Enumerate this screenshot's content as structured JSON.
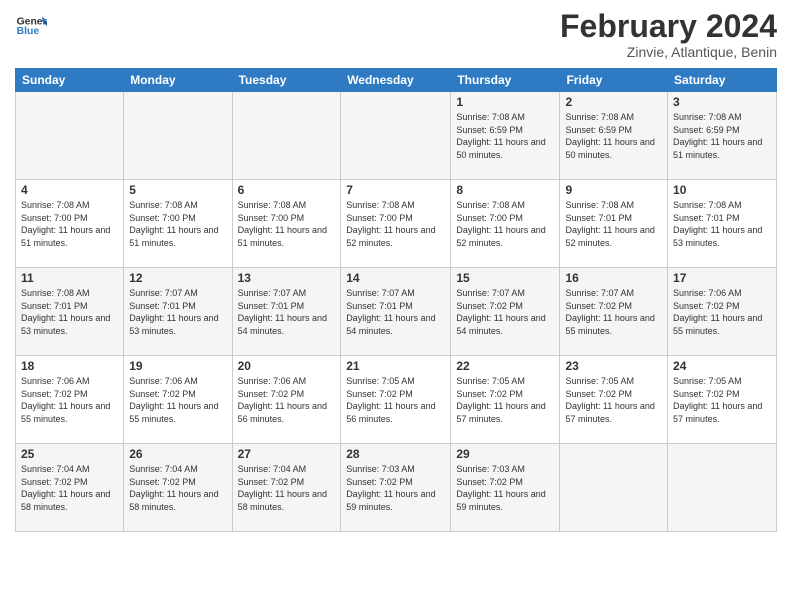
{
  "logo": {
    "text_general": "General",
    "text_blue": "Blue"
  },
  "header": {
    "month_year": "February 2024",
    "location": "Zinvie, Atlantique, Benin"
  },
  "weekdays": [
    "Sunday",
    "Monday",
    "Tuesday",
    "Wednesday",
    "Thursday",
    "Friday",
    "Saturday"
  ],
  "weeks": [
    [
      {
        "day": "",
        "sunrise": "",
        "sunset": "",
        "daylight": ""
      },
      {
        "day": "",
        "sunrise": "",
        "sunset": "",
        "daylight": ""
      },
      {
        "day": "",
        "sunrise": "",
        "sunset": "",
        "daylight": ""
      },
      {
        "day": "",
        "sunrise": "",
        "sunset": "",
        "daylight": ""
      },
      {
        "day": "1",
        "sunrise": "Sunrise: 7:08 AM",
        "sunset": "Sunset: 6:59 PM",
        "daylight": "Daylight: 11 hours and 50 minutes."
      },
      {
        "day": "2",
        "sunrise": "Sunrise: 7:08 AM",
        "sunset": "Sunset: 6:59 PM",
        "daylight": "Daylight: 11 hours and 50 minutes."
      },
      {
        "day": "3",
        "sunrise": "Sunrise: 7:08 AM",
        "sunset": "Sunset: 6:59 PM",
        "daylight": "Daylight: 11 hours and 51 minutes."
      }
    ],
    [
      {
        "day": "4",
        "sunrise": "Sunrise: 7:08 AM",
        "sunset": "Sunset: 7:00 PM",
        "daylight": "Daylight: 11 hours and 51 minutes."
      },
      {
        "day": "5",
        "sunrise": "Sunrise: 7:08 AM",
        "sunset": "Sunset: 7:00 PM",
        "daylight": "Daylight: 11 hours and 51 minutes."
      },
      {
        "day": "6",
        "sunrise": "Sunrise: 7:08 AM",
        "sunset": "Sunset: 7:00 PM",
        "daylight": "Daylight: 11 hours and 51 minutes."
      },
      {
        "day": "7",
        "sunrise": "Sunrise: 7:08 AM",
        "sunset": "Sunset: 7:00 PM",
        "daylight": "Daylight: 11 hours and 52 minutes."
      },
      {
        "day": "8",
        "sunrise": "Sunrise: 7:08 AM",
        "sunset": "Sunset: 7:00 PM",
        "daylight": "Daylight: 11 hours and 52 minutes."
      },
      {
        "day": "9",
        "sunrise": "Sunrise: 7:08 AM",
        "sunset": "Sunset: 7:01 PM",
        "daylight": "Daylight: 11 hours and 52 minutes."
      },
      {
        "day": "10",
        "sunrise": "Sunrise: 7:08 AM",
        "sunset": "Sunset: 7:01 PM",
        "daylight": "Daylight: 11 hours and 53 minutes."
      }
    ],
    [
      {
        "day": "11",
        "sunrise": "Sunrise: 7:08 AM",
        "sunset": "Sunset: 7:01 PM",
        "daylight": "Daylight: 11 hours and 53 minutes."
      },
      {
        "day": "12",
        "sunrise": "Sunrise: 7:07 AM",
        "sunset": "Sunset: 7:01 PM",
        "daylight": "Daylight: 11 hours and 53 minutes."
      },
      {
        "day": "13",
        "sunrise": "Sunrise: 7:07 AM",
        "sunset": "Sunset: 7:01 PM",
        "daylight": "Daylight: 11 hours and 54 minutes."
      },
      {
        "day": "14",
        "sunrise": "Sunrise: 7:07 AM",
        "sunset": "Sunset: 7:01 PM",
        "daylight": "Daylight: 11 hours and 54 minutes."
      },
      {
        "day": "15",
        "sunrise": "Sunrise: 7:07 AM",
        "sunset": "Sunset: 7:02 PM",
        "daylight": "Daylight: 11 hours and 54 minutes."
      },
      {
        "day": "16",
        "sunrise": "Sunrise: 7:07 AM",
        "sunset": "Sunset: 7:02 PM",
        "daylight": "Daylight: 11 hours and 55 minutes."
      },
      {
        "day": "17",
        "sunrise": "Sunrise: 7:06 AM",
        "sunset": "Sunset: 7:02 PM",
        "daylight": "Daylight: 11 hours and 55 minutes."
      }
    ],
    [
      {
        "day": "18",
        "sunrise": "Sunrise: 7:06 AM",
        "sunset": "Sunset: 7:02 PM",
        "daylight": "Daylight: 11 hours and 55 minutes."
      },
      {
        "day": "19",
        "sunrise": "Sunrise: 7:06 AM",
        "sunset": "Sunset: 7:02 PM",
        "daylight": "Daylight: 11 hours and 55 minutes."
      },
      {
        "day": "20",
        "sunrise": "Sunrise: 7:06 AM",
        "sunset": "Sunset: 7:02 PM",
        "daylight": "Daylight: 11 hours and 56 minutes."
      },
      {
        "day": "21",
        "sunrise": "Sunrise: 7:05 AM",
        "sunset": "Sunset: 7:02 PM",
        "daylight": "Daylight: 11 hours and 56 minutes."
      },
      {
        "day": "22",
        "sunrise": "Sunrise: 7:05 AM",
        "sunset": "Sunset: 7:02 PM",
        "daylight": "Daylight: 11 hours and 57 minutes."
      },
      {
        "day": "23",
        "sunrise": "Sunrise: 7:05 AM",
        "sunset": "Sunset: 7:02 PM",
        "daylight": "Daylight: 11 hours and 57 minutes."
      },
      {
        "day": "24",
        "sunrise": "Sunrise: 7:05 AM",
        "sunset": "Sunset: 7:02 PM",
        "daylight": "Daylight: 11 hours and 57 minutes."
      }
    ],
    [
      {
        "day": "25",
        "sunrise": "Sunrise: 7:04 AM",
        "sunset": "Sunset: 7:02 PM",
        "daylight": "Daylight: 11 hours and 58 minutes."
      },
      {
        "day": "26",
        "sunrise": "Sunrise: 7:04 AM",
        "sunset": "Sunset: 7:02 PM",
        "daylight": "Daylight: 11 hours and 58 minutes."
      },
      {
        "day": "27",
        "sunrise": "Sunrise: 7:04 AM",
        "sunset": "Sunset: 7:02 PM",
        "daylight": "Daylight: 11 hours and 58 minutes."
      },
      {
        "day": "28",
        "sunrise": "Sunrise: 7:03 AM",
        "sunset": "Sunset: 7:02 PM",
        "daylight": "Daylight: 11 hours and 59 minutes."
      },
      {
        "day": "29",
        "sunrise": "Sunrise: 7:03 AM",
        "sunset": "Sunset: 7:02 PM",
        "daylight": "Daylight: 11 hours and 59 minutes."
      },
      {
        "day": "",
        "sunrise": "",
        "sunset": "",
        "daylight": ""
      },
      {
        "day": "",
        "sunrise": "",
        "sunset": "",
        "daylight": ""
      }
    ]
  ]
}
